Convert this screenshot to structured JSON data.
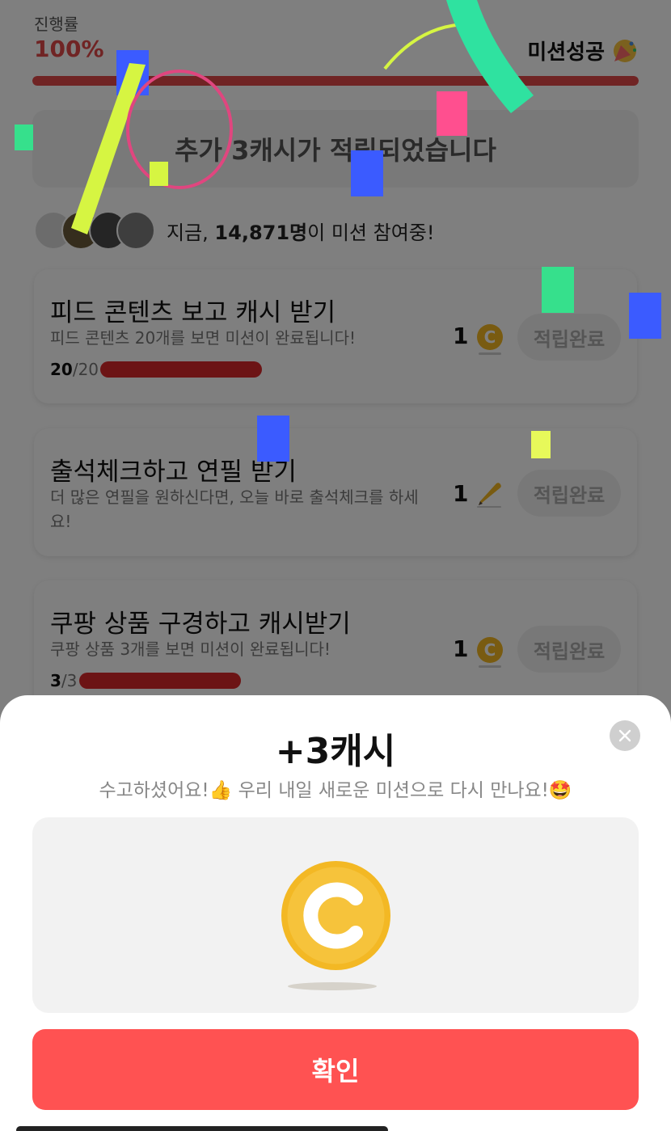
{
  "header": {
    "progress_label": "진행률",
    "progress_value": "100%",
    "progress_fraction": 1.0,
    "mission_status": "미션성공",
    "status_icon": "party-popper-icon"
  },
  "bonus_banner": {
    "text": "추가 3캐시가 적립되었습니다"
  },
  "participants": {
    "prefix": "지금, ",
    "count": "14,871명",
    "suffix": "이 미션 참여중!"
  },
  "missions": [
    {
      "title": "피드 콘텐츠 보고 캐시 받기",
      "desc": "피드 콘텐츠 20개를 보면 미션이 완료됩니다!",
      "done": "20",
      "total": "/20",
      "progress_fraction": 1.0,
      "reward": "1",
      "reward_icon": "coin-icon",
      "button": "적립완료"
    },
    {
      "title": "출석체크하고 연필 받기",
      "desc": "더 많은 연필을 원하신다면, 오늘 바로 출석체크를 하세요!",
      "reward": "1",
      "reward_icon": "pencil-icon",
      "button": "적립완료"
    },
    {
      "title": "쿠팡 상품 구경하고 캐시받기",
      "desc": "쿠팡 상품 3개를 보면 미션이 완료됩니다!",
      "done": "3",
      "total": "/3",
      "progress_fraction": 1.0,
      "reward": "1",
      "reward_icon": "coin-icon",
      "button": "적립완료"
    }
  ],
  "modal": {
    "title": "+3캐시",
    "subtitle": "수고하셨어요!👍 우리 내일 새로운 미션으로 다시 만나요!🤩",
    "coin_icon": "big-coin-icon",
    "confirm_label": "확인",
    "close_icon": "close-icon"
  },
  "colors": {
    "accent": "#e04848",
    "confirm": "#ff5252",
    "coin": "#f2b622",
    "overlay": "rgba(0,0,0,0.5)"
  }
}
